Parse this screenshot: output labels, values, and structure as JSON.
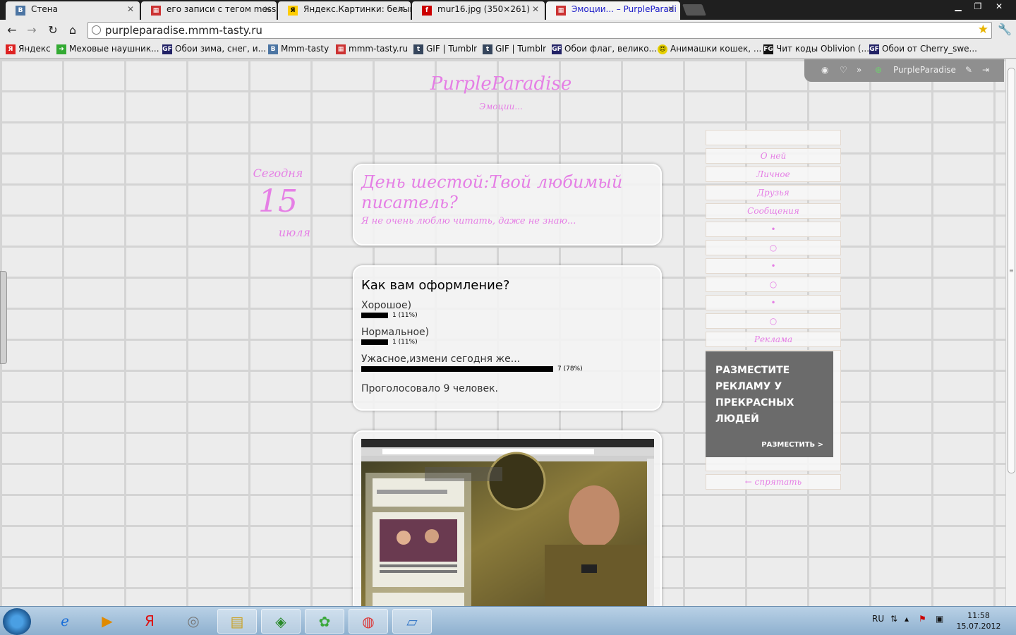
{
  "tabs": [
    {
      "label": "Стена",
      "favicon": "vk-icon",
      "color": "#4c75a3"
    },
    {
      "label": "его записи с тегом mess -",
      "favicon": "mmm-tasty-icon",
      "color": "#cc3333"
    },
    {
      "label": "Яндекс.Картинки: белый",
      "favicon": "yandex-images-icon",
      "color": "#ffcc00"
    },
    {
      "label": "mur16.jpg (350×261)",
      "favicon": "free-icon",
      "color": "#cc0000"
    },
    {
      "label": "Эмоции... – PurpleParadi",
      "favicon": "mmm-tasty-icon",
      "color": "#cc3333"
    }
  ],
  "address_bar": {
    "url": "purpleparadise.mmm-tasty.ru"
  },
  "bookmarks": [
    {
      "label": "Яндекс",
      "icon": "yandex-icon"
    },
    {
      "label": "Меховые наушник...",
      "icon": "green-arrow-icon"
    },
    {
      "label": "Обои зима, снег, и...",
      "icon": "wallpaper-icon"
    },
    {
      "label": "Mmm-tasty",
      "icon": "vk-icon"
    },
    {
      "label": "mmm-tasty.ru",
      "icon": "mmm-tasty-icon"
    },
    {
      "label": "GIF | Tumblr",
      "icon": "tumblr-icon"
    },
    {
      "label": "GIF | Tumblr",
      "icon": "tumblr-icon"
    },
    {
      "label": "Обои флаг, велико...",
      "icon": "wallpaper-icon"
    },
    {
      "label": "Анимашки кошек, ...",
      "icon": "smiley-icon"
    },
    {
      "label": "Чит коды Oblivion (...",
      "icon": "fg-icon"
    },
    {
      "label": "Обои от Cherry_swe...",
      "icon": "wallpaper-icon"
    }
  ],
  "control_bar": {
    "username": "PurpleParadise"
  },
  "blog": {
    "title": "PurpleParadise",
    "subtitle": "Эмоции..."
  },
  "date": {
    "label": "Сегодня",
    "day": "15",
    "month": "июля"
  },
  "post1": {
    "title": "День шестой:Твой любимый писатель?",
    "excerpt": "Я не очень люблю читать, даже не знаю..."
  },
  "poll": {
    "question": "Как вам оформление?",
    "options": [
      {
        "label": "Хорошое)",
        "votes_text": "1 (11%)",
        "fraction": 0.11
      },
      {
        "label": "Нормальное)",
        "votes_text": "1 (11%)",
        "fraction": 0.11
      },
      {
        "label": "Ужасное,измени сегодня же...",
        "votes_text": "7 (78%)",
        "fraction": 0.78
      }
    ],
    "total": "Проголосовало 9 человек."
  },
  "menu": {
    "items": [
      "",
      "О ней",
      "Личное",
      "Друзья",
      "Сообщения",
      "•",
      "○",
      "•",
      "○",
      "•",
      "○",
      "Реклама"
    ],
    "hide": "← спрятать"
  },
  "ad": {
    "text": "РАЗМЕСТИТЕ РЕКЛАМУ У ПРЕКРАСНЫХ ЛЮДЕЙ",
    "link": "РАЗМЕСТИТЬ >"
  },
  "taskbar": {
    "lang": "RU",
    "time": "11:58",
    "date": "15.07.2012",
    "apps": [
      "ie-icon",
      "media-player-icon",
      "yandex-icon",
      "audio-icon",
      "explorer-icon",
      "antivirus-icon",
      "icq-icon",
      "chrome-icon",
      "notepad-icon"
    ]
  }
}
